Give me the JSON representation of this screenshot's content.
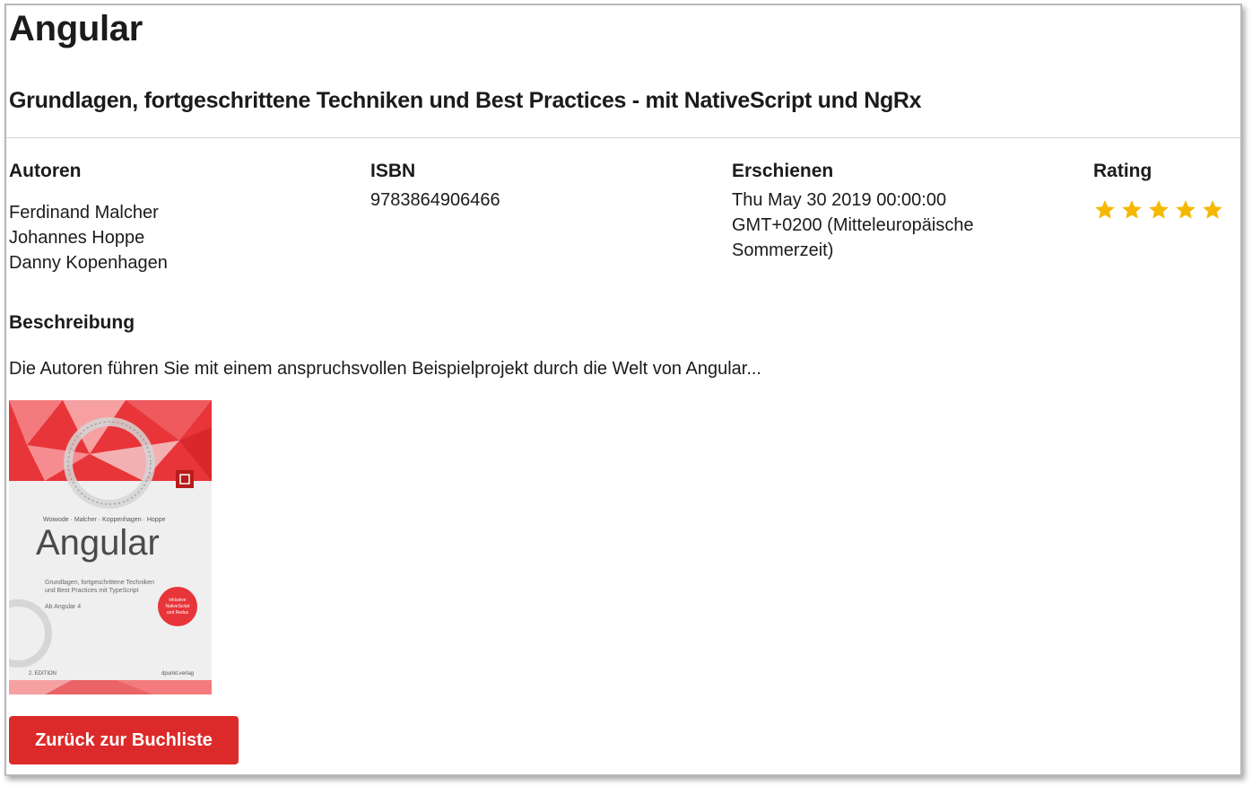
{
  "book": {
    "title": "Angular",
    "subtitle": "Grundlagen, fortgeschrittene Techniken und Best Practices - mit NativeScript und NgRx"
  },
  "details": {
    "authors_label": "Autoren",
    "authors": [
      "Ferdinand Malcher",
      "Johannes Hoppe",
      "Danny Kopenhagen"
    ],
    "isbn_label": "ISBN",
    "isbn": "9783864906466",
    "published_label": "Erschienen",
    "published_lines": [
      "Thu May 30 2019 00:00:00",
      "GMT+0200 (Mitteleuropäische",
      "Sommerzeit)"
    ],
    "rating_label": "Rating",
    "rating": 5,
    "rating_color": "#f5b800"
  },
  "description": {
    "label": "Beschreibung",
    "text": "Die Autoren führen Sie mit einem anspruchsvollen Beispielprojekt durch die Welt von Angular..."
  },
  "cover": {
    "authors": "Woiwode · Malcher · Koppenhagen · Hoppe",
    "title": "Angular",
    "subtitle_lines": [
      "Grundlagen, fortgeschrittene Techniken",
      "und Best Practices mit TypeScript"
    ],
    "version": "Ab Angular 4",
    "badge_lines": [
      "inklusive",
      "NativeScript",
      "und Redux"
    ],
    "edition": "2. EDITION",
    "publisher": "dpunkt.verlag",
    "accent_color": "#e8353a"
  },
  "actions": {
    "back_label": "Zurück zur Buchliste"
  }
}
